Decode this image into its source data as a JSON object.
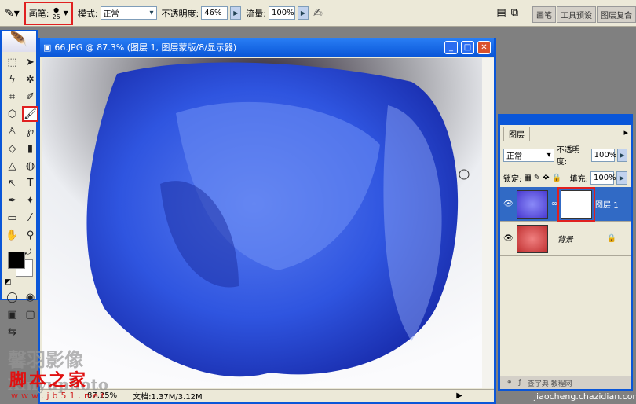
{
  "options": {
    "brush_label": "画笔:",
    "brush_size": "25",
    "mode_label": "模式:",
    "mode_value": "正常",
    "opacity_label": "不透明度:",
    "opacity_value": "46%",
    "flow_label": "流量:",
    "flow_value": "100%"
  },
  "wells": [
    "画笔",
    "工具预设",
    "图层复合"
  ],
  "document": {
    "title": "66.JPG @ 87.3% (图层 1, 图层蒙版/8/显示器)",
    "zoom": "87.25%",
    "doc_size": "文档:1.37M/3.12M"
  },
  "layers_panel": {
    "tab": "图层",
    "blend_mode": "正常",
    "opacity_label": "不透明度:",
    "opacity_value": "100%",
    "lock_label": "锁定:",
    "fill_label": "填充:",
    "fill_value": "100%",
    "layers": [
      {
        "name": "图层 1",
        "active": true
      },
      {
        "name": "背景",
        "active": false,
        "locked": true
      }
    ]
  },
  "watermarks": {
    "line1": "馨羽影像",
    "line2": "Xinyuphoto",
    "site_name": "脚本之家",
    "site_url": "www.jb51.net",
    "bottom": "jiaocheng.chazidian.com",
    "bottom2": "查字典 教程网"
  },
  "colors": {
    "accent": "#0a56d8",
    "highlight": "#e02020",
    "rose": "#2a4fd8"
  }
}
